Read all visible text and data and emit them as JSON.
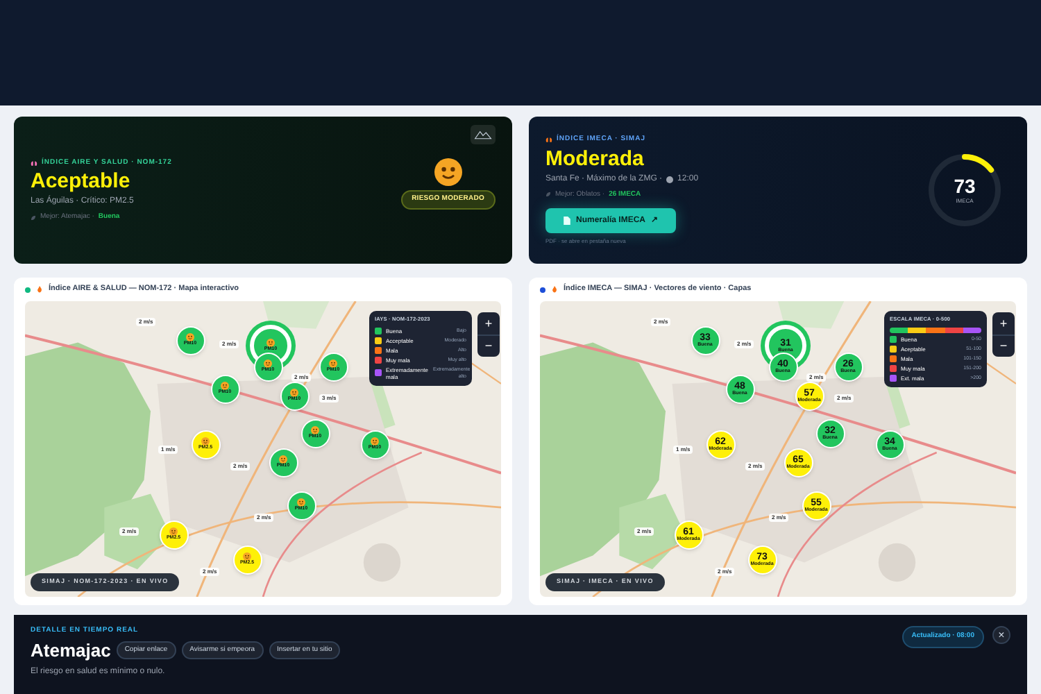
{
  "summary_cards": [
    {
      "kind": "aire",
      "eyebrow": "ÍNDICE AIRE Y SALUD · NOM-172",
      "status": "Aceptable",
      "subtitle": "Las Águilas · Crítico: PM2.5",
      "best_prefix": "Mejor: Atemajac ·",
      "best_value": "Buena",
      "risk": "RIESGO MODERADO"
    },
    {
      "kind": "imeca",
      "eyebrow": "ÍNDICE IMECA · SIMAJ",
      "status": "Moderada",
      "subtitle": "Santa Fe · Máximo de la ZMG ·",
      "time": "12:00",
      "best_prefix": "Mejor: Oblatos ·",
      "best_value": "26 IMECA",
      "button": "Numeralía IMECA",
      "button_icon": "↗",
      "note": "PDF · se abre en pestaña nueva",
      "gauge_value": "73",
      "gauge_unit": "IMECA",
      "level": 0.146
    }
  ],
  "maps": [
    {
      "kind": "aire",
      "title": "Índice AIRE & SALUD — NOM-172 · Mapa interactivo",
      "color": "#10b981",
      "legend_title": "IAYS · NOM-172-2023",
      "legend": [
        {
          "name": "Buena",
          "risk": "Bajo",
          "color": "#22c55e"
        },
        {
          "name": "Acceptable",
          "risk": "Moderado",
          "color": "#facc15"
        },
        {
          "name": "Mala",
          "risk": "Alto",
          "color": "#f97316"
        },
        {
          "name": "Muy mala",
          "risk": "Muy alto",
          "color": "#ef4444"
        },
        {
          "name": "Extremadamente mala",
          "risk": "Extremadamente alto",
          "color": "#a855f7"
        }
      ],
      "markers": [
        {
          "label": "PM10",
          "color": "#22c55e",
          "selected": false
        },
        {
          "label": "PM10",
          "color": "#22c55e",
          "selected": true
        },
        {
          "label": "PM10",
          "color": "#22c55e",
          "selected": false
        },
        {
          "label": "PM10",
          "color": "#22c55e",
          "selected": false
        },
        {
          "label": "PM10",
          "color": "#22c55e",
          "selected": false
        },
        {
          "label": "PM10",
          "color": "#22c55e",
          "selected": false
        },
        {
          "label": "PM10",
          "color": "#22c55e",
          "selected": false
        },
        {
          "label": "PM2.5",
          "color": "#fef008",
          "selected": false
        },
        {
          "label": "PM10",
          "color": "#22c55e",
          "selected": false
        },
        {
          "label": "PM10",
          "color": "#22c55e",
          "selected": false
        },
        {
          "label": "PM10",
          "color": "#22c55e",
          "selected": false
        },
        {
          "label": "PM2.5",
          "color": "#fef008",
          "selected": false
        },
        {
          "label": "PM2.5",
          "color": "#fef008",
          "selected": false
        }
      ],
      "wind": [
        "2 m/s",
        "2 m/s",
        "2 m/s",
        "3 m/s",
        "1 m/s",
        "2 m/s",
        "2 m/s",
        "2 m/s",
        "2 m/s"
      ],
      "zoom_in": "+",
      "zoom_out": "−",
      "badge": "SIMAJ · NOM-172-2023 · EN VIVO"
    },
    {
      "kind": "imeca",
      "title": "Índice IMECA — SIMAJ · Vectores de viento · Capas",
      "color": "#1d4ed8",
      "legend_title": "ESCALA IMECA · 0-500",
      "legend": [
        {
          "name": "Buena",
          "risk": "0-50",
          "color": "#22c55e"
        },
        {
          "name": "Aceptable",
          "risk": "51-100",
          "color": "#facc15"
        },
        {
          "name": "Mala",
          "risk": "101-150",
          "color": "#f97316"
        },
        {
          "name": "Muy mala",
          "risk": "151-200",
          "color": "#ef4444"
        },
        {
          "name": "Ext. mala",
          "risk": ">200",
          "color": "#a855f7"
        }
      ],
      "markers": [
        {
          "value": "33",
          "label": "Buena",
          "color": "#22c55e",
          "selected": false
        },
        {
          "value": "31",
          "label": "Buena",
          "color": "#22c55e",
          "selected": true
        },
        {
          "value": "40",
          "label": "Buena",
          "color": "#22c55e",
          "selected": false
        },
        {
          "value": "26",
          "label": "Buena",
          "color": "#22c55e",
          "selected": false
        },
        {
          "value": "48",
          "label": "Buena",
          "color": "#22c55e",
          "selected": false
        },
        {
          "value": "57",
          "label": "Moderada",
          "color": "#fef008",
          "selected": false
        },
        {
          "value": "32",
          "label": "Buena",
          "color": "#22c55e",
          "selected": false
        },
        {
          "value": "62",
          "label": "Moderada",
          "color": "#fef008",
          "selected": false
        },
        {
          "value": "34",
          "label": "Buena",
          "color": "#22c55e",
          "selected": false
        },
        {
          "value": "65",
          "label": "Moderada",
          "color": "#fef008",
          "selected": false
        },
        {
          "value": "55",
          "label": "Moderada",
          "color": "#fef008",
          "selected": false
        },
        {
          "value": "61",
          "label": "Moderada",
          "color": "#fef008",
          "selected": false
        },
        {
          "value": "73",
          "label": "Moderada",
          "color": "#fef008",
          "selected": false
        }
      ],
      "wind": [
        "2 m/s",
        "2 m/s",
        "2 m/s",
        "2 m/s",
        "1 m/s",
        "2 m/s",
        "2 m/s",
        "2 m/s",
        "2 m/s"
      ],
      "zoom_in": "+",
      "zoom_out": "−",
      "badge": "SIMAJ · IMECA · EN VIVO"
    }
  ],
  "detail": {
    "eyebrow": "DETALLE EN TIEMPO REAL",
    "station": "Atemajac",
    "actions": [
      "Copiar enlace",
      "Avisarme si empeora",
      "Insertar en tu sitio"
    ],
    "description": "El riesgo en salud es mínimo o nulo.",
    "updated": "Actualizado · 08:00",
    "close": "×"
  }
}
